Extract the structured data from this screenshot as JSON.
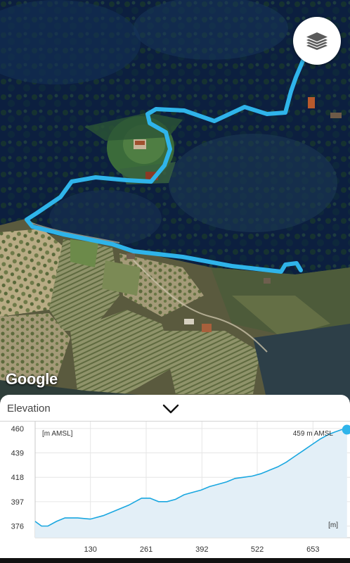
{
  "map": {
    "attribution": "Google",
    "layers_button_icon": "layers-icon",
    "route_color": "#2fb4ea"
  },
  "panel": {
    "title": "Elevation",
    "collapse_icon": "chevron-down-icon"
  },
  "chart_data": {
    "type": "area",
    "ylabel": "[m AMSL]",
    "xlabel": "[m]",
    "max_label": "459 m AMSL",
    "y_ticks": [
      460,
      439,
      418,
      397,
      376
    ],
    "x_ticks": [
      130,
      261,
      392,
      522,
      653
    ],
    "ylim": [
      366,
      466
    ],
    "xlim": [
      0,
      740
    ],
    "line_color": "#1aa7e0",
    "fill_color": "#e3eff7",
    "x": [
      0,
      15,
      30,
      50,
      70,
      100,
      130,
      160,
      180,
      200,
      220,
      235,
      250,
      270,
      290,
      310,
      330,
      350,
      370,
      390,
      410,
      430,
      450,
      470,
      490,
      510,
      530,
      550,
      570,
      590,
      610,
      630,
      650,
      670,
      690,
      705,
      720,
      733
    ],
    "y": [
      380,
      376,
      376,
      380,
      383,
      383,
      382,
      385,
      388,
      391,
      394,
      397,
      400,
      400,
      397,
      397,
      399,
      403,
      405,
      407,
      410,
      412,
      414,
      417,
      418,
      419,
      421,
      424,
      427,
      431,
      436,
      441,
      446,
      451,
      455,
      457,
      459,
      459
    ]
  }
}
